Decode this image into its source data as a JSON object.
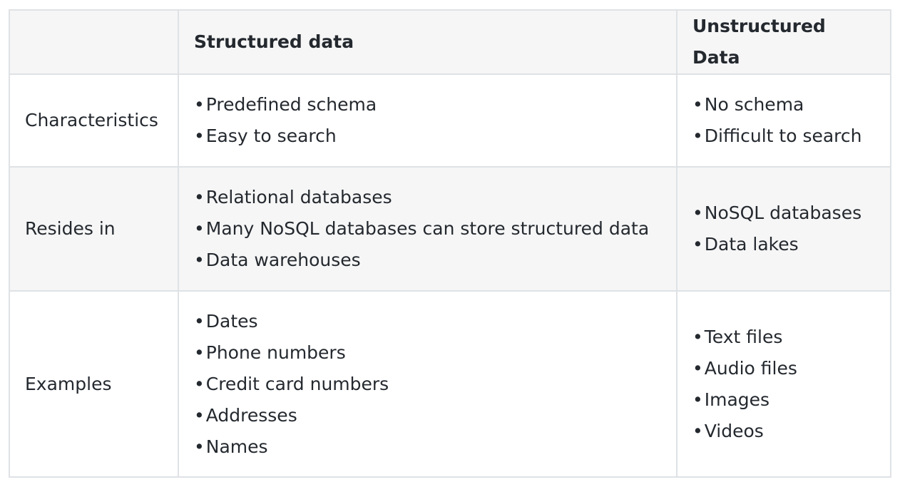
{
  "table": {
    "headers": [
      "",
      "Structured data",
      "Unstructured Data"
    ],
    "rows": [
      {
        "label": "Characteristics",
        "structured": [
          "Predefined schema",
          "Easy to search"
        ],
        "unstructured": [
          "No schema",
          "Difficult to search"
        ]
      },
      {
        "label": "Resides in",
        "structured": [
          "Relational databases",
          "Many NoSQL databases can store structured data",
          "Data warehouses"
        ],
        "unstructured": [
          "NoSQL databases",
          "Data lakes"
        ]
      },
      {
        "label": "Examples",
        "structured": [
          "Dates",
          "Phone numbers",
          "Credit card numbers",
          "Addresses",
          "Names"
        ],
        "unstructured": [
          "Text files",
          "Audio files",
          "Images",
          "Videos"
        ]
      }
    ],
    "bullet": "•"
  }
}
